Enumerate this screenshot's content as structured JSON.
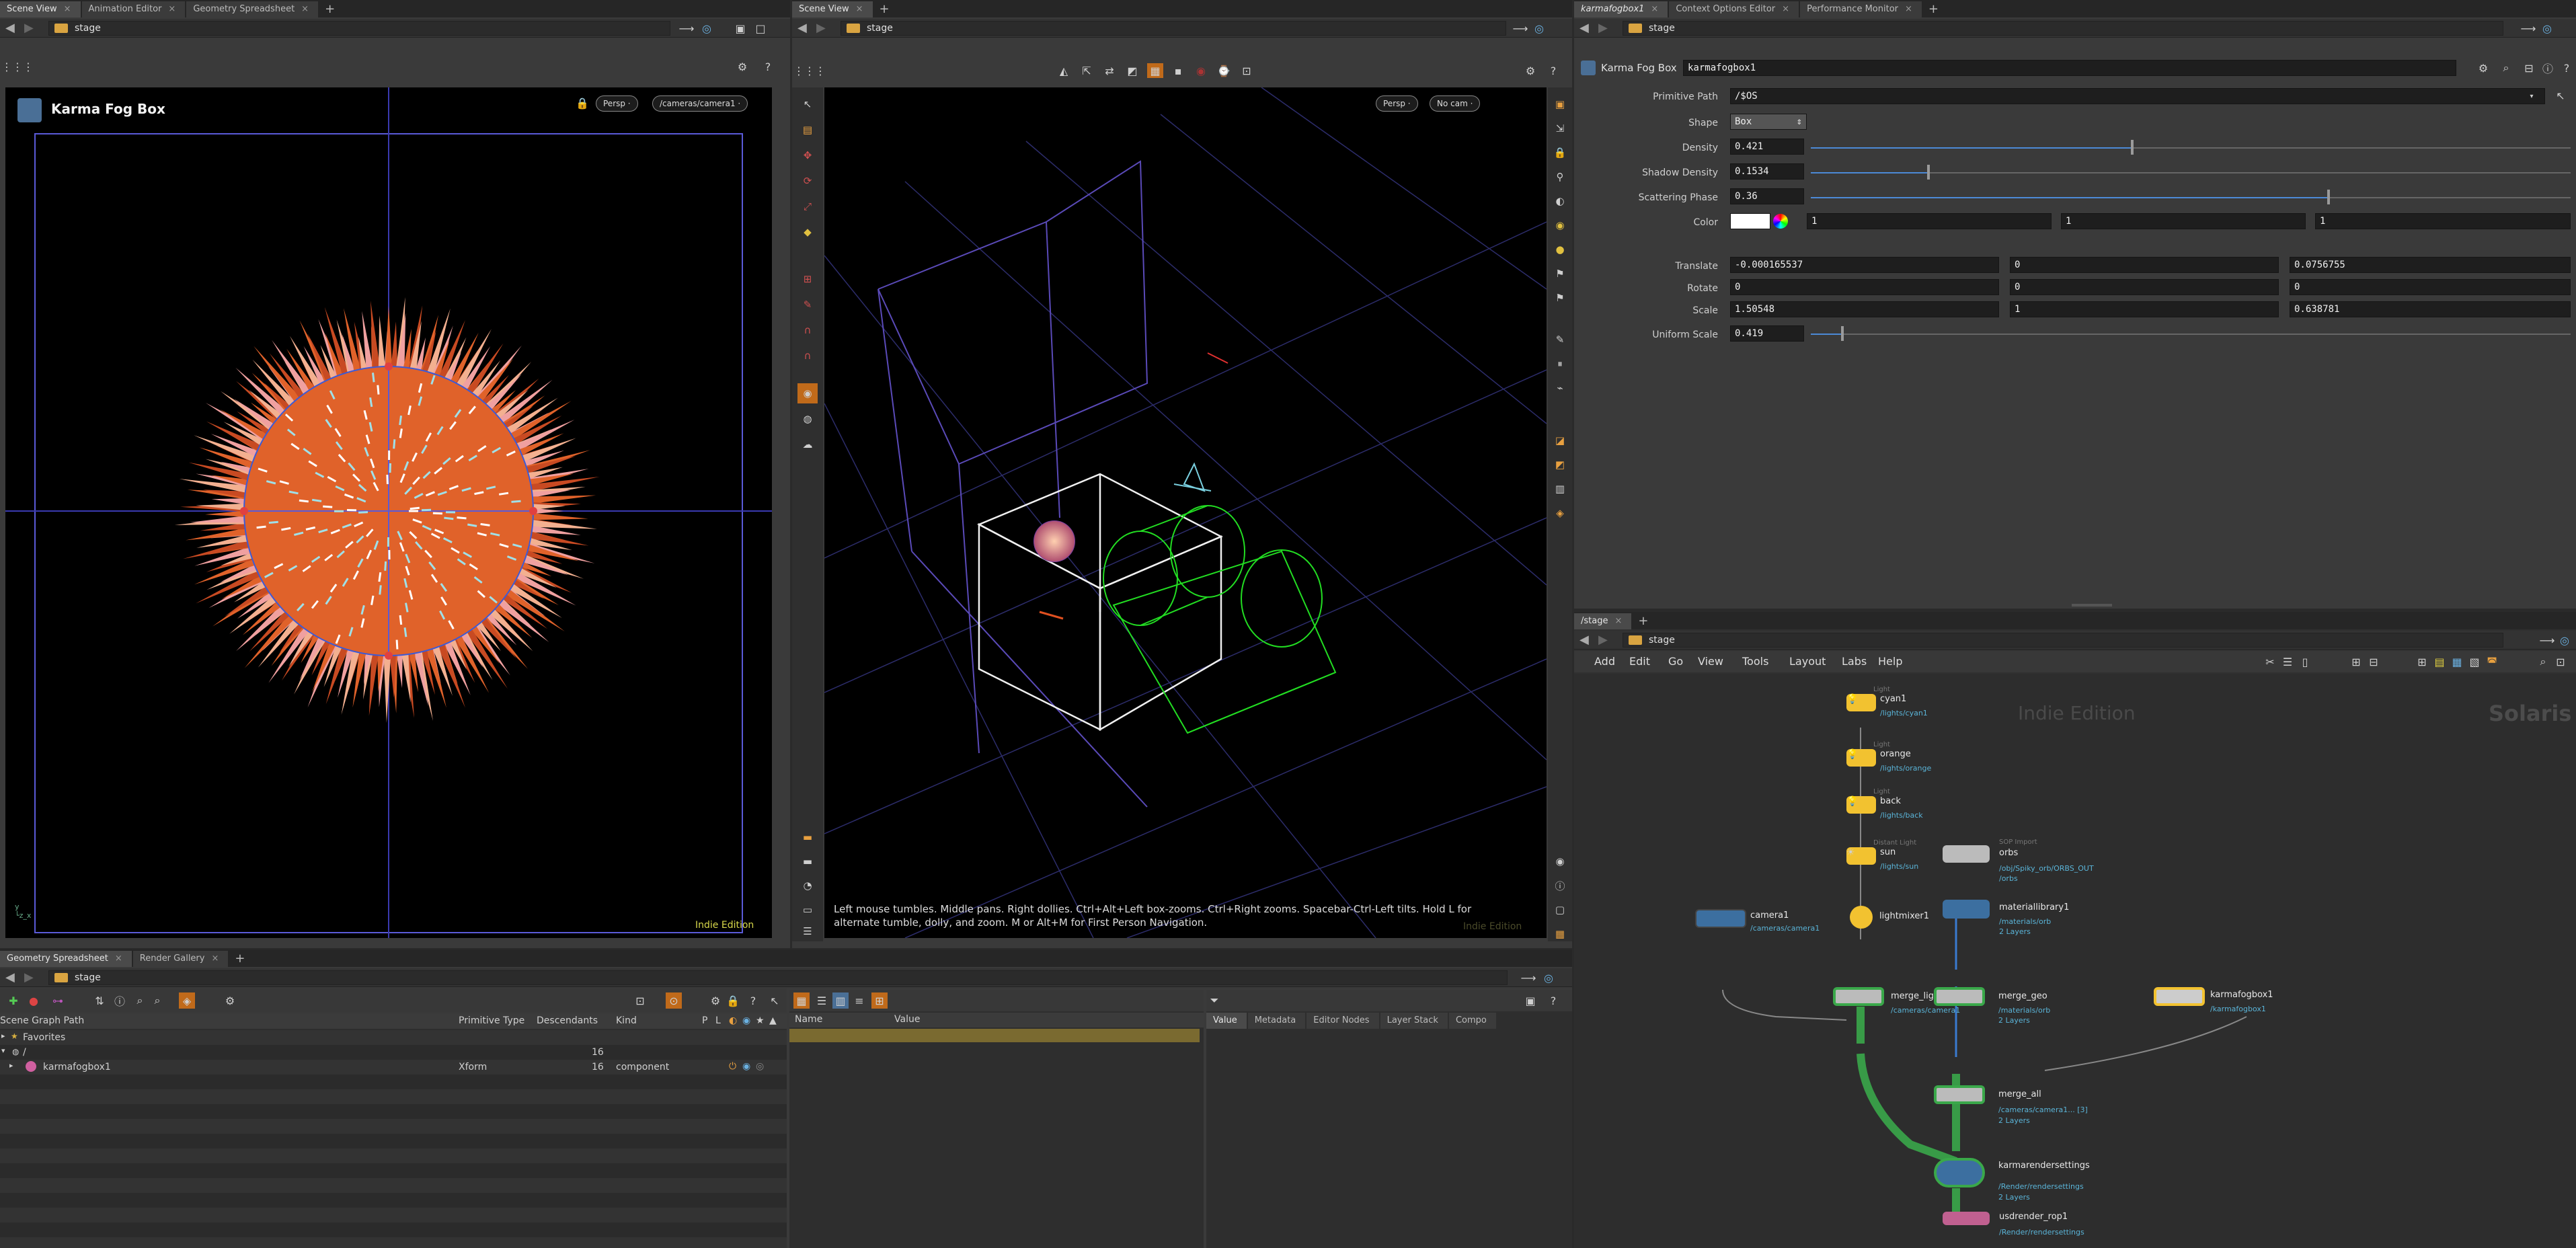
{
  "left_pane": {
    "tabs": [
      {
        "label": "Scene View"
      },
      {
        "label": "Animation Editor"
      },
      {
        "label": "Geometry Spreadsheet"
      }
    ],
    "path": "stage",
    "node_header": "Karma Fog Box",
    "persp": "Persp ·",
    "camera": "/cameras/camera1 ·",
    "edition": "Indie Edition"
  },
  "mid_pane": {
    "tabs": [
      {
        "label": "Scene View"
      }
    ],
    "path": "stage",
    "persp": "Persp ·",
    "camera": "No cam ·",
    "hint": "Left mouse tumbles. Middle pans. Right dollies. Ctrl+Alt+Left box-zooms. Ctrl+Right zooms. Spacebar-Ctrl-Left tilts. Hold L for alternate tumble, dolly, and zoom. M or Alt+M for First Person Navigation.",
    "edition": "Indie Edition"
  },
  "params": {
    "tabs": [
      {
        "label": "karmafogbox1"
      },
      {
        "label": "Context Options Editor"
      },
      {
        "label": "Performance Monitor"
      }
    ],
    "path": "stage",
    "type": "Karma Fog Box",
    "name": "karmafogbox1",
    "primitive_path_label": "Primitive Path",
    "primitive_path": "/$OS",
    "shape_label": "Shape",
    "shape": "Box",
    "density_label": "Density",
    "density": "0.421",
    "density_frac": 0.421,
    "shadow_density_label": "Shadow Density",
    "shadow_density": "0.1534",
    "shadow_density_frac": 0.1534,
    "scattering_phase_label": "Scattering Phase",
    "scattering_phase": "0.36",
    "scattering_phase_frac": 0.68,
    "color_label": "Color",
    "color": [
      "1",
      "1",
      "1"
    ],
    "translate_label": "Translate",
    "translate": [
      "-0.000165537",
      "0",
      "0.0756755"
    ],
    "rotate_label": "Rotate",
    "rotate": [
      "0",
      "0",
      "0"
    ],
    "scale_label": "Scale",
    "scale": [
      "1.50548",
      "1",
      "0.638781"
    ],
    "uniform_scale_label": "Uniform Scale",
    "uniform_scale": "0.419",
    "uniform_scale_frac": 0.04
  },
  "network": {
    "tabs": [
      {
        "label": "/stage"
      }
    ],
    "path": "stage",
    "menu": [
      "Add",
      "Edit",
      "Go",
      "View",
      "Tools",
      "Layout",
      "Labs",
      "Help"
    ],
    "watermark": "Indie Edition",
    "context": "Solaris",
    "nodes": {
      "cyan1": {
        "type": "Light",
        "name": "cyan1",
        "sub": "/lights/cyan1"
      },
      "orange": {
        "type": "Light",
        "name": "orange",
        "sub": "/lights/orange"
      },
      "back": {
        "type": "Light",
        "name": "back",
        "sub": "/lights/back"
      },
      "sun": {
        "type": "Distant Light",
        "name": "sun",
        "sub": "/lights/sun"
      },
      "lightmixer1": {
        "name": "lightmixer1"
      },
      "camera1": {
        "name": "camera1",
        "sub": "/cameras/camera1"
      },
      "merge_light_cam": {
        "name": "merge_light_cam",
        "sub": "/cameras/camera1"
      },
      "orbs": {
        "type": "SOP Import",
        "name": "orbs",
        "sub": "/obj/Spiky_orb/ORBS_OUT",
        "sub2": "/orbs"
      },
      "materiallibrary1": {
        "name": "materiallibrary1",
        "sub": "/materials/orb",
        "sub2": "2 Layers"
      },
      "merge_geo": {
        "name": "merge_geo",
        "sub": "/materials/orb",
        "sub2": "2 Layers"
      },
      "karmafogbox1": {
        "name": "karmafogbox1",
        "sub": "/karmafogbox1"
      },
      "merge_all": {
        "name": "merge_all",
        "sub": "/cameras/camera1... [3]",
        "sub2": "2 Layers"
      },
      "karmarendersettings": {
        "name": "karmarendersettings",
        "sub": "/Render/rendersettings",
        "sub2": "2 Layers"
      },
      "usdrender_rop1": {
        "name": "usdrender_rop1",
        "sub": "/Render/rendersettings"
      }
    }
  },
  "spreadsheet": {
    "tabs": [
      {
        "label": "Geometry Spreadsheet"
      },
      {
        "label": "Render Gallery"
      }
    ],
    "path": "stage",
    "headers": {
      "path": "Scene Graph Path",
      "prim_type": "Primitive Type",
      "descendants": "Descendants",
      "kind": "Kind"
    },
    "flags": [
      "P",
      "L",
      "◐",
      "◉",
      "★",
      "▲"
    ],
    "rows": [
      {
        "path": "Favorites",
        "prim_type": "",
        "descendants": "",
        "kind": ""
      },
      {
        "path": "/",
        "prim_type": "",
        "descendants": "16",
        "kind": ""
      },
      {
        "path": "karmafogbox1",
        "prim_type": "Xform",
        "descendants": "16",
        "kind": "component"
      }
    ],
    "name_header": "Name",
    "value_header": "Value",
    "right_tabs": [
      {
        "label": "Value"
      },
      {
        "label": "Metadata"
      },
      {
        "label": "Editor Nodes"
      },
      {
        "label": "Layer Stack"
      },
      {
        "label": "Compo"
      }
    ]
  },
  "colors": {
    "node_yellow": "#f2c230",
    "wire_green": "#3aa84a",
    "path_blue": "#5ab4d8"
  }
}
